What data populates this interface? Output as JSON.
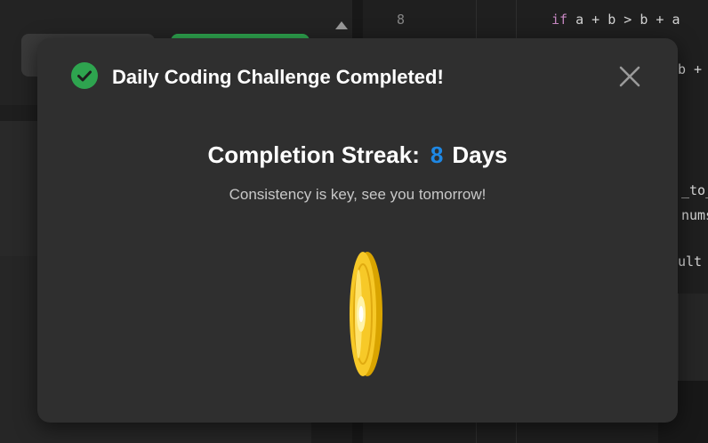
{
  "background": {
    "editor": {
      "line_number": "8",
      "code_line_keyword": "if",
      "code_line_rest": " a + b > b + a",
      "fragments": [
        "b +",
        "_to_",
        "nums",
        "ult"
      ]
    }
  },
  "dialog": {
    "title": "Daily Coding Challenge Completed!",
    "streak_label": "Completion Streak:",
    "streak_value": "8",
    "streak_unit": "Days",
    "subtext": "Consistency is key, see you tomorrow!",
    "icons": {
      "title_icon": "check-circle-icon",
      "close_icon": "close-icon",
      "reward_icon": "gold-coin-icon"
    },
    "colors": {
      "success": "#2ea44f",
      "streak_accent": "#1e88e5",
      "coin": "#f5c518"
    }
  }
}
